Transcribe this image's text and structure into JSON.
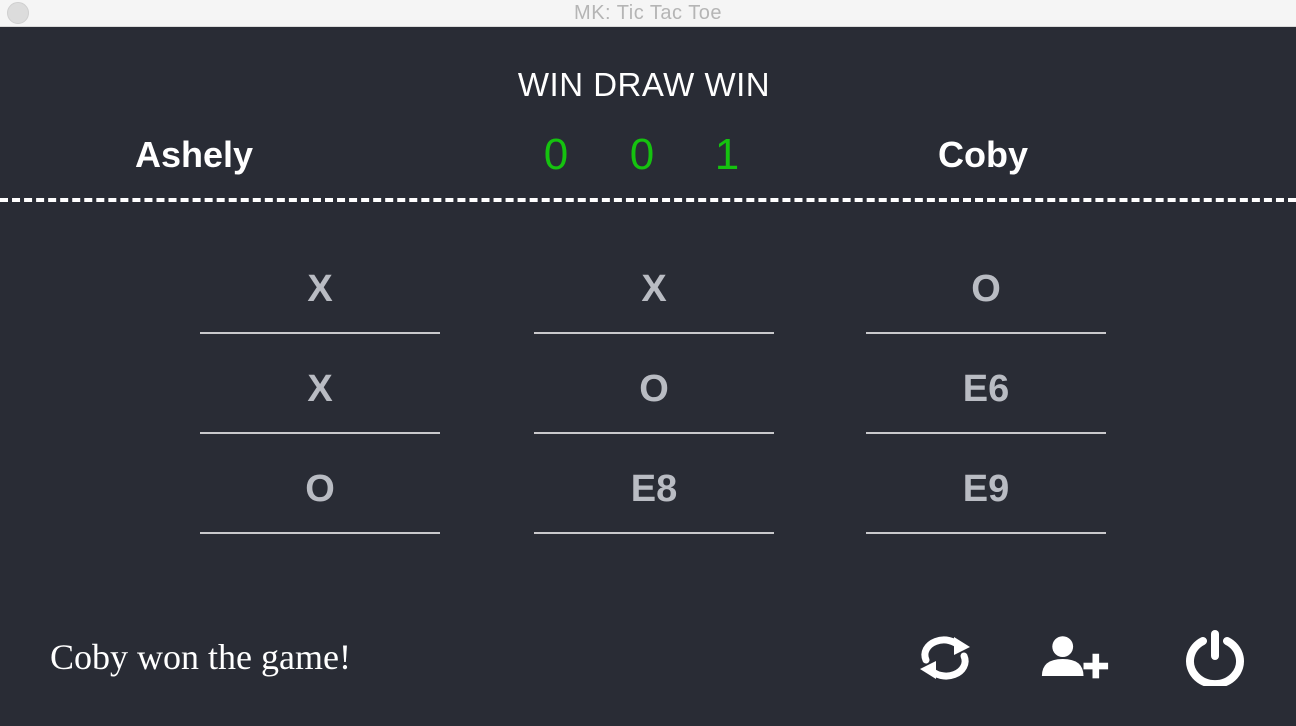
{
  "window": {
    "title": "MK: Tic Tac Toe"
  },
  "scoreboard": {
    "labels": "WIN DRAW WIN",
    "player1": "Ashely",
    "player2": "Coby",
    "scores": [
      "0",
      "0",
      "1"
    ]
  },
  "board": {
    "cells": [
      "X",
      "X",
      "O",
      "X",
      "O",
      "E6",
      "O",
      "E8",
      "E9"
    ]
  },
  "status": "Coby won the game!",
  "actions": {
    "icons": [
      "restart-icon",
      "add-player-icon",
      "power-icon"
    ]
  },
  "colors": {
    "background": "#292c35",
    "score": "#15c20f",
    "cell_text": "#b9bcc3"
  }
}
